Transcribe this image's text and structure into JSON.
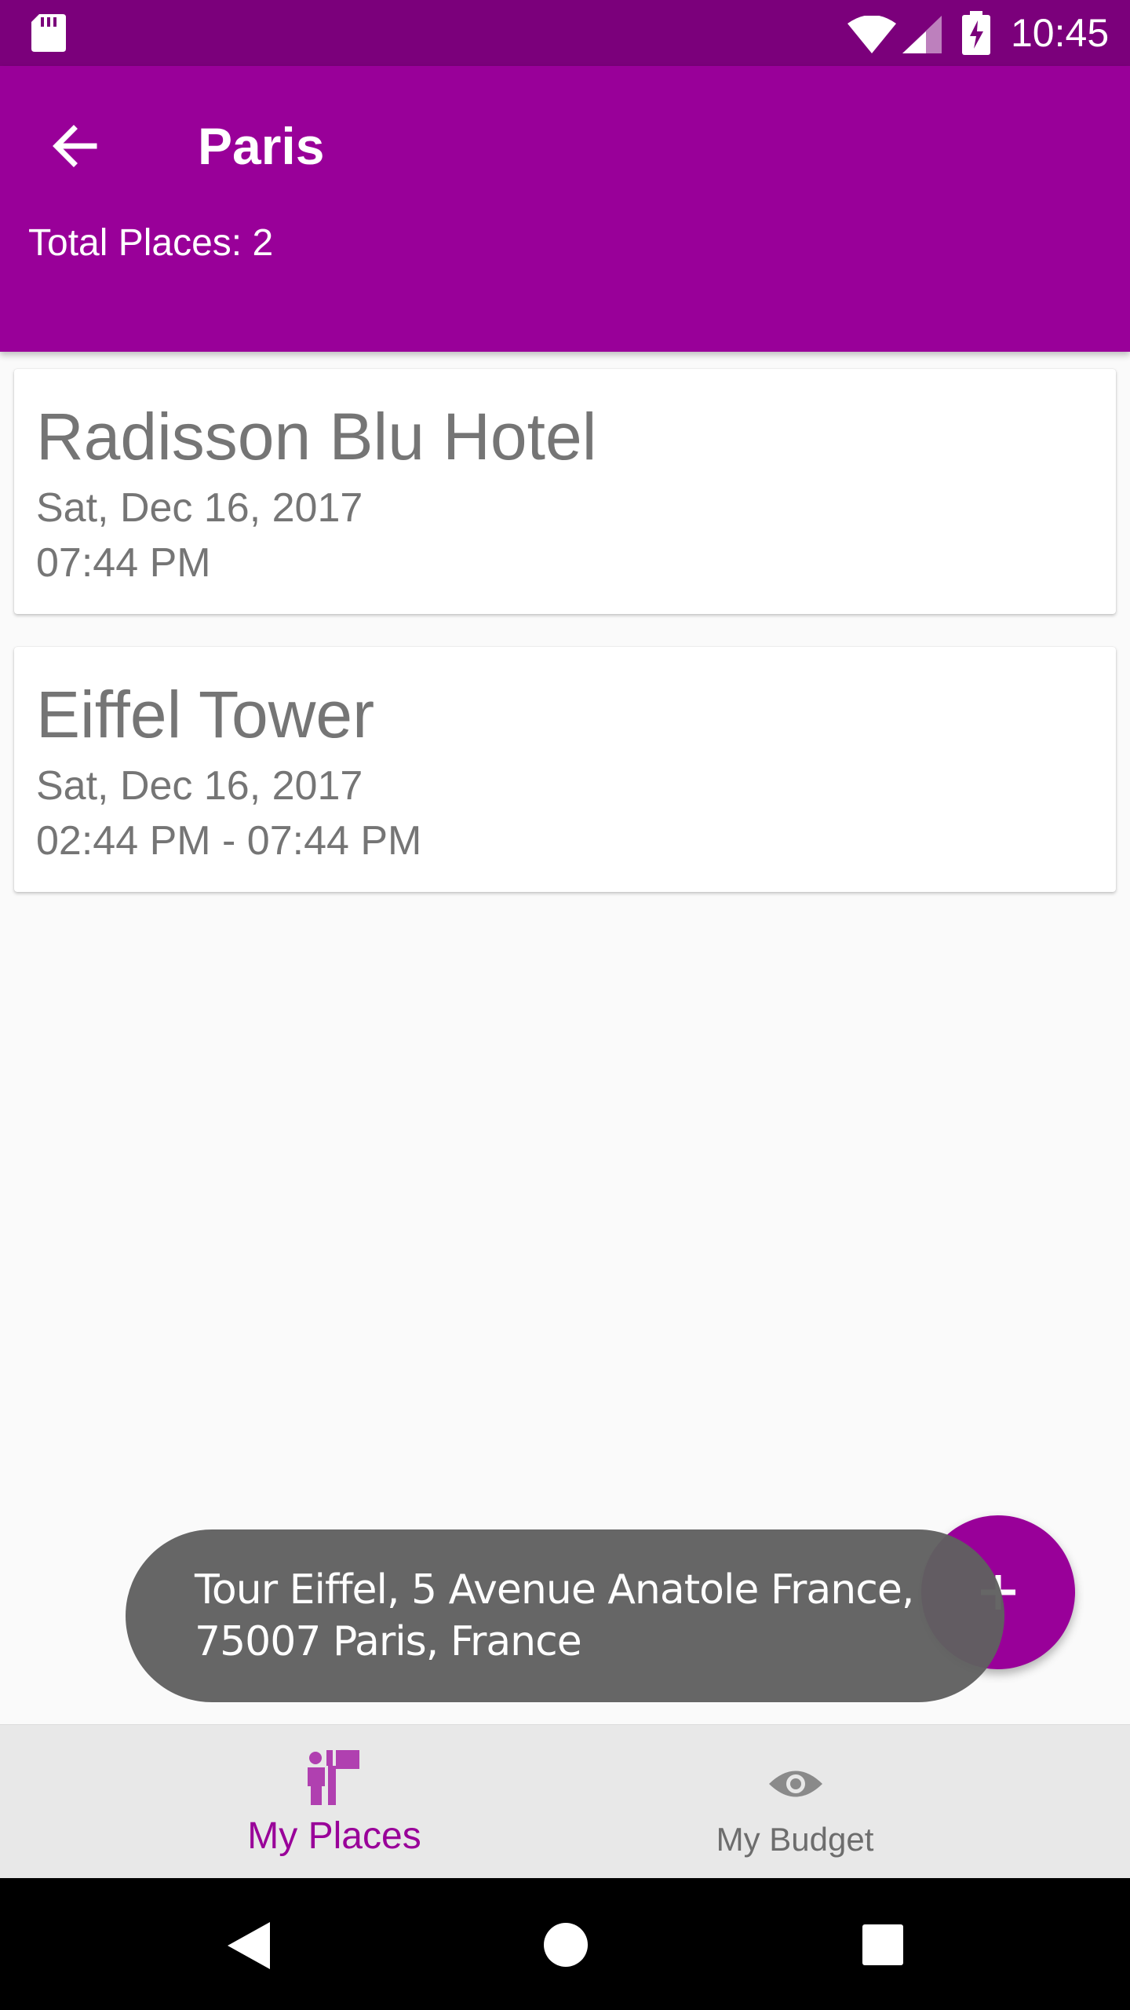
{
  "status_bar": {
    "time": "10:45",
    "icons": [
      "sd-card-icon",
      "wifi-icon",
      "signal-icon",
      "battery-charging-icon"
    ]
  },
  "app_bar": {
    "title": "Paris",
    "subtitle": "Total Places: 2",
    "back_icon": "arrow-back-icon",
    "background_color": "#990099",
    "status_color": "#7b007b"
  },
  "places": [
    {
      "name": "Radisson Blu Hotel",
      "date": "Sat, Dec 16, 2017",
      "time": "07:44 PM"
    },
    {
      "name": "Eiffel Tower",
      "date": "Sat, Dec 16, 2017",
      "time": "02:44 PM - 07:44 PM"
    }
  ],
  "fab": {
    "icon": "plus-icon",
    "color": "#990099"
  },
  "toast": {
    "line1": "Tour Eiffel, 5 Avenue Anatole France,",
    "line2": "75007 Paris, France"
  },
  "bottom_nav": {
    "items": [
      {
        "label": "My Places",
        "icon": "places-flag-icon",
        "active": true,
        "color": "#990099"
      },
      {
        "label": "My Budget",
        "icon": "eye-icon",
        "active": false,
        "color": "#6d6d6d"
      }
    ]
  },
  "system_nav": {
    "icons": [
      "back-triangle-icon",
      "home-circle-icon",
      "recents-square-icon"
    ]
  }
}
